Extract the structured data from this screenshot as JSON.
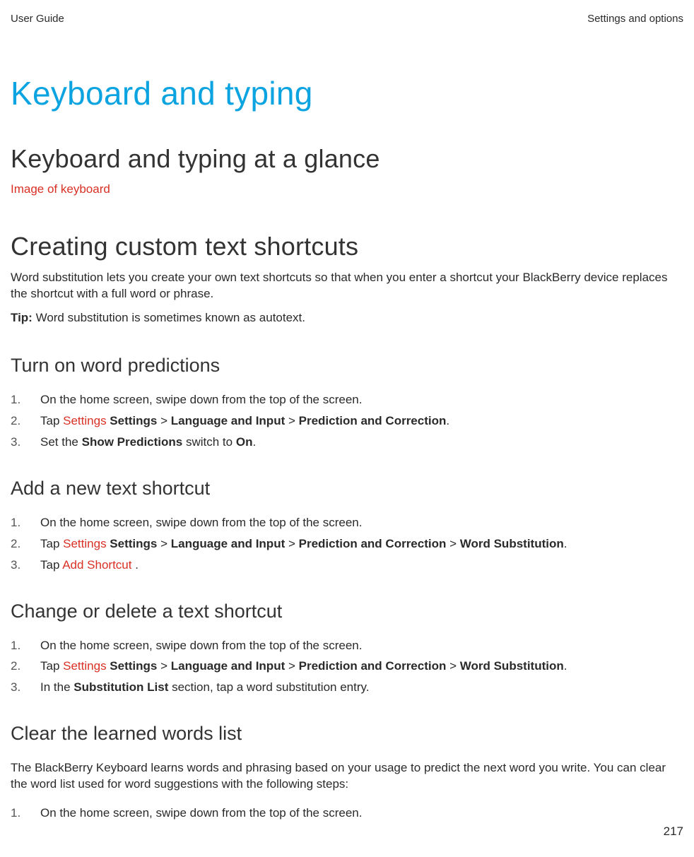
{
  "header": {
    "left": "User Guide",
    "right": "Settings and options"
  },
  "h1": "Keyboard and typing",
  "section_glance": {
    "h2": "Keyboard and typing at a glance",
    "image_placeholder": "Image of keyboard"
  },
  "section_shortcuts": {
    "h2": "Creating custom text shortcuts",
    "intro": "Word substitution lets you create your own text shortcuts so that when you enter a shortcut your BlackBerry device replaces the shortcut with a full word or phrase.",
    "tip_label": "Tip:",
    "tip_text": " Word substitution is sometimes known as autotext."
  },
  "sub_predictions": {
    "h3": "Turn on word predictions",
    "step1": "On the home screen, swipe down from the top of the screen.",
    "step2_prefix": "Tap ",
    "step2_icon": "Settings",
    "step2_bold1": " Settings",
    "step2_gt1": " > ",
    "step2_bold2": "Language and Input",
    "step2_gt2": " > ",
    "step2_bold3": "Prediction and Correction",
    "step2_suffix": ".",
    "step3_prefix": "Set the ",
    "step3_bold1": "Show Predictions",
    "step3_mid": " switch to ",
    "step3_bold2": "On",
    "step3_suffix": "."
  },
  "sub_add": {
    "h3": "Add a new text shortcut",
    "step1": "On the home screen, swipe down from the top of the screen.",
    "step2_prefix": "Tap ",
    "step2_icon": "Settings",
    "step2_bold1": " Settings",
    "step2_gt1": " > ",
    "step2_bold2": "Language and Input",
    "step2_gt2": " > ",
    "step2_bold3": "Prediction and Correction",
    "step2_gt3": " > ",
    "step2_bold4": "Word Substitution",
    "step2_suffix": ".",
    "step3_prefix": "Tap ",
    "step3_icon": "Add Shortcut",
    "step3_suffix": " ."
  },
  "sub_change": {
    "h3": "Change or delete a text shortcut",
    "step1": "On the home screen, swipe down from the top of the screen.",
    "step2_prefix": "Tap ",
    "step2_icon": "Settings",
    "step2_bold1": " Settings",
    "step2_gt1": " > ",
    "step2_bold2": "Language and Input",
    "step2_gt2": " > ",
    "step2_bold3": "Prediction and Correction",
    "step2_gt3": " > ",
    "step2_bold4": "Word Substitution",
    "step2_suffix": ".",
    "step3_prefix": "In the ",
    "step3_bold": "Substitution List",
    "step3_suffix": " section, tap a word substitution entry."
  },
  "sub_clear": {
    "h3": "Clear the learned words list",
    "intro": "The BlackBerry Keyboard learns words and phrasing based on your usage to predict the next word you write. You can clear the word list used for word suggestions with the following steps:",
    "step1": "On the home screen, swipe down from the top of the screen."
  },
  "page_number": "217"
}
